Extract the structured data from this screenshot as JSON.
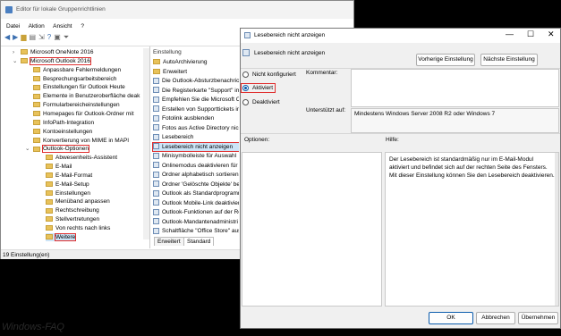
{
  "main_window": {
    "title": "Editor für lokale Gruppenrichtlinien",
    "menu": [
      "Datei",
      "Aktion",
      "Ansicht",
      "?"
    ],
    "tree": [
      {
        "label": "Microsoft OneNote 2016",
        "level": 1
      },
      {
        "label": "Microsoft Outlook 2016",
        "level": 1
      },
      {
        "label": "Anpassbare Fehlermeldungen",
        "level": 2
      },
      {
        "label": "Besprechungsarbeitsbereich",
        "level": 2
      },
      {
        "label": "Einstellungen für Outlook Heute",
        "level": 2
      },
      {
        "label": "Elemente in Benutzeroberfläche deak",
        "level": 2
      },
      {
        "label": "Formularbereicheinstellungen",
        "level": 2
      },
      {
        "label": "Homepages für Outlook-Ordner mit",
        "level": 2
      },
      {
        "label": "InfoPath-Integration",
        "level": 2
      },
      {
        "label": "Kontoeinstellungen",
        "level": 2
      },
      {
        "label": "Konvertierung von MIME in MAPI",
        "level": 2
      },
      {
        "label": "Outlook-Optionen",
        "level": 2
      },
      {
        "label": "Abwesenheits-Assistent",
        "level": 3
      },
      {
        "label": "E-Mail",
        "level": 3
      },
      {
        "label": "E-Mail-Format",
        "level": 3
      },
      {
        "label": "E-Mail-Setup",
        "level": 3
      },
      {
        "label": "Einstellungen",
        "level": 3
      },
      {
        "label": "Menüband anpassen",
        "level": 3
      },
      {
        "label": "Rechtschreibung",
        "level": 3
      },
      {
        "label": "Stellvertretungen",
        "level": 3
      },
      {
        "label": "Von rechts nach links",
        "level": 3
      },
      {
        "label": "Weitere",
        "level": 3
      }
    ],
    "list_header": "Einstellung",
    "list_items": [
      {
        "label": "AutoArchivierung",
        "kind": "folder"
      },
      {
        "label": "Enweitert",
        "kind": "folder"
      },
      {
        "label": "Die Outlook-Absturzbenachric",
        "kind": "policy"
      },
      {
        "label": "Die Registerkarte \"Support\" im",
        "kind": "policy"
      },
      {
        "label": "Empfehlen Sie die Microsoft O",
        "kind": "policy"
      },
      {
        "label": "Erstellen von Supporttickets in",
        "kind": "policy"
      },
      {
        "label": "Fotolink ausblenden",
        "kind": "policy"
      },
      {
        "label": "Fotos aus Active Directory nich",
        "kind": "policy"
      },
      {
        "label": "Lesebereich",
        "kind": "policy"
      },
      {
        "label": "Lesebereich nicht anzeigen",
        "kind": "policy"
      },
      {
        "label": "Minisymbolleiste für Auswahl",
        "kind": "policy"
      },
      {
        "label": "Onlinemodus deaktivieren für",
        "kind": "policy"
      },
      {
        "label": "Ordner alphabetisch sortieren",
        "kind": "policy"
      },
      {
        "label": "Ordner 'Gelöschte Objekte' bei",
        "kind": "policy"
      },
      {
        "label": "Outlook als Standardprogramm",
        "kind": "policy"
      },
      {
        "label": "Outlook Mobile-Link deaktivier",
        "kind": "policy"
      },
      {
        "label": "Outlook-Funktionen auf der Re",
        "kind": "policy"
      },
      {
        "label": "Outlook-Mandantenadministri",
        "kind": "policy"
      },
      {
        "label": "Schaltfläche \"Office Store\" aus",
        "kind": "policy"
      }
    ],
    "tabs": [
      "Erweitert",
      "Standard"
    ],
    "status": "19 Einstellung(en)"
  },
  "dialog": {
    "title": "Lesebereich nicht anzeigen",
    "heading": "Lesebereich nicht anzeigen",
    "prev_button": "Vorherige Einstellung",
    "next_button": "Nächste Einstellung",
    "radios": [
      "Nicht konfiguriert",
      "Aktiviert",
      "Deaktiviert"
    ],
    "comment_label": "Kommentar:",
    "supported_label": "Unterstützt auf:",
    "supported_value": "Mindestens Windows Server 2008 R2 oder Windows 7",
    "options_label": "Optionen:",
    "help_label": "Hilfe:",
    "help_text": "Der Lesebereich ist standardmäßig nur im E-Mail-Modul aktiviert und befindet sich auf der rechten Seite des Fensters. Mit dieser Einstellung können Sie den Lesebereich deaktivieren.",
    "ok": "OK",
    "cancel": "Abbrechen",
    "apply": "Übernehmen"
  },
  "watermark": "Windows-FAQ"
}
